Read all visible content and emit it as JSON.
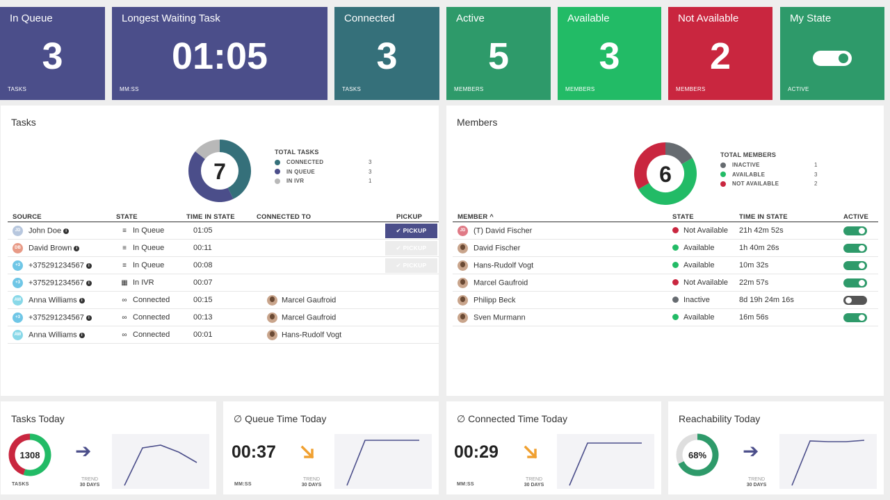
{
  "colors": {
    "indigo": "#4b4e8a",
    "teal": "#35707a",
    "green_dark": "#2e9a6a",
    "green": "#22bb66",
    "red": "#c9263f",
    "gray": "#b8b8b8",
    "dark_gray": "#666b70",
    "orange": "#f0a030"
  },
  "tiles": {
    "in_queue": {
      "title": "In Queue",
      "value": "3",
      "unit": "TASKS"
    },
    "longest": {
      "title": "Longest Waiting Task",
      "value": "01:05",
      "unit": "MM:SS"
    },
    "connected": {
      "title": "Connected",
      "value": "3",
      "unit": "TASKS"
    },
    "active": {
      "title": "Active",
      "value": "5",
      "unit": "MEMBERS"
    },
    "available": {
      "title": "Available",
      "value": "3",
      "unit": "MEMBERS"
    },
    "not_available": {
      "title": "Not Available",
      "value": "2",
      "unit": "MEMBERS"
    },
    "my_state": {
      "title": "My State",
      "unit": "ACTIVE",
      "toggle_on": true
    }
  },
  "tasks_panel": {
    "title": "Tasks",
    "total": "7",
    "legend_title": "TOTAL TASKS",
    "legend": [
      {
        "label": "CONNECTED",
        "value": "3",
        "color": "#35707a"
      },
      {
        "label": "IN QUEUE",
        "value": "3",
        "color": "#4b4e8a"
      },
      {
        "label": "IN IVR",
        "value": "1",
        "color": "#b8b8b8"
      }
    ],
    "headers": {
      "source": "SOURCE",
      "state": "STATE",
      "time": "TIME IN STATE",
      "connected_to": "CONNECTED TO",
      "pickup": "PICKUP"
    },
    "pickup_label": "PICKUP",
    "rows": [
      {
        "initials": "JD",
        "avatar_color": "#b7c7de",
        "source": "John Doe",
        "state_icon": "layers-icon",
        "state": "In Queue",
        "time": "01:05",
        "connected_to": "",
        "pickup": "enabled"
      },
      {
        "initials": "DB",
        "avatar_color": "#e89a86",
        "source": "David Brown",
        "state_icon": "layers-icon",
        "state": "In Queue",
        "time": "00:11",
        "connected_to": "",
        "pickup": "disabled"
      },
      {
        "initials": "+3",
        "avatar_color": "#6fc6e6",
        "source": "+375291234567",
        "state_icon": "layers-icon",
        "state": "In Queue",
        "time": "00:08",
        "connected_to": "",
        "pickup": "disabled"
      },
      {
        "initials": "+3",
        "avatar_color": "#6fc6e6",
        "source": "+375291234567",
        "state_icon": "grid-icon",
        "state": "In IVR",
        "time": "00:07",
        "connected_to": "",
        "pickup": "none"
      },
      {
        "initials": "AW",
        "avatar_color": "#88d8e8",
        "source": "Anna Williams",
        "state_icon": "link-icon",
        "state": "Connected",
        "time": "00:15",
        "connected_to": "Marcel Gaufroid",
        "pickup": "none"
      },
      {
        "initials": "+3",
        "avatar_color": "#6fc6e6",
        "source": "+375291234567",
        "state_icon": "link-icon",
        "state": "Connected",
        "time": "00:13",
        "connected_to": "Marcel Gaufroid",
        "pickup": "none"
      },
      {
        "initials": "AW",
        "avatar_color": "#88d8e8",
        "source": "Anna Williams",
        "state_icon": "link-icon",
        "state": "Connected",
        "time": "00:01",
        "connected_to": "Hans-Rudolf Vogt",
        "pickup": "none"
      }
    ]
  },
  "members_panel": {
    "title": "Members",
    "total": "6",
    "legend_title": "TOTAL MEMBERS",
    "legend": [
      {
        "label": "INACTIVE",
        "value": "1",
        "color": "#666b70"
      },
      {
        "label": "AVAILABLE",
        "value": "3",
        "color": "#22bb66"
      },
      {
        "label": "NOT AVAILABLE",
        "value": "2",
        "color": "#c9263f"
      }
    ],
    "headers": {
      "member": "MEMBER ^",
      "state": "STATE",
      "time": "TIME IN STATE",
      "active": "ACTIVE"
    },
    "rows": [
      {
        "initials": "JD",
        "avatar_color": "#e07a86",
        "name": "(T) David Fischer",
        "state": "Not Available",
        "state_color": "#c9263f",
        "time": "21h 42m 52s",
        "active": true
      },
      {
        "initials": "",
        "avatar_color": "",
        "name": "David Fischer",
        "state": "Available",
        "state_color": "#22bb66",
        "time": "1h 40m 26s",
        "active": true
      },
      {
        "initials": "",
        "avatar_color": "",
        "name": "Hans-Rudolf Vogt",
        "state": "Available",
        "state_color": "#22bb66",
        "time": "10m 32s",
        "active": true
      },
      {
        "initials": "",
        "avatar_color": "",
        "name": "Marcel Gaufroid",
        "state": "Not Available",
        "state_color": "#c9263f",
        "time": "22m 57s",
        "active": true
      },
      {
        "initials": "",
        "avatar_color": "",
        "name": "Philipp Beck",
        "state": "Inactive",
        "state_color": "#666b70",
        "time": "8d 19h 24m 16s",
        "active": false
      },
      {
        "initials": "",
        "avatar_color": "",
        "name": "Sven Murmann",
        "state": "Available",
        "state_color": "#22bb66",
        "time": "16m 56s",
        "active": true
      }
    ]
  },
  "today": {
    "tasks": {
      "title": "Tasks Today",
      "value": "1308",
      "unit": "TASKS",
      "trend_l1": "TREND",
      "trend_l2": "30 DAYS",
      "trend_icon": "arrow-right-icon",
      "ring_green_fraction": 0.55
    },
    "queue": {
      "title": "∅ Queue Time Today",
      "value": "00:37",
      "unit": "MM:SS",
      "trend_l1": "TREND",
      "trend_l2": "30 DAYS",
      "trend_icon": "arrow-down-right-icon"
    },
    "connected": {
      "title": "∅ Connected Time Today",
      "value": "00:29",
      "unit": "MM:SS",
      "trend_l1": "TREND",
      "trend_l2": "30 DAYS",
      "trend_icon": "arrow-down-right-icon"
    },
    "reach": {
      "title": "Reachability Today",
      "value": "68%",
      "trend_l1": "TREND",
      "trend_l2": "30 DAYS",
      "trend_icon": "arrow-right-icon",
      "ring_fraction": 0.68
    }
  }
}
